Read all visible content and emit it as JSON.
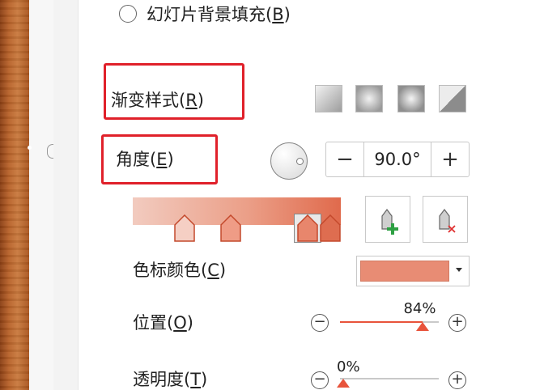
{
  "fill_options": {
    "slide_background_fill_label": "幻灯片背景填充",
    "slide_background_fill_key": "B"
  },
  "gradient": {
    "style_label": "渐变样式",
    "style_key": "R",
    "styles": [
      "linear",
      "radial",
      "rectangular",
      "path"
    ],
    "angle_label": "角度",
    "angle_key": "E",
    "angle_value": "90.0°",
    "decrement": "−",
    "increment": "+",
    "stops": [
      {
        "position": 0.25,
        "color": "#f5cfc4"
      },
      {
        "position": 0.47,
        "color": "#ef9c86"
      },
      {
        "position": 0.84,
        "color": "#e8866c",
        "selected": true
      },
      {
        "position": 0.95,
        "color": "#de6d50"
      }
    ]
  },
  "stop_color": {
    "label": "色标颜色",
    "key": "C",
    "value_color": "#e88c74"
  },
  "position": {
    "label": "位置",
    "key": "O",
    "value": "84%",
    "fraction": 0.84
  },
  "transparency": {
    "label": "透明度",
    "key": "T",
    "value": "0%",
    "fraction": 0.0
  },
  "colors": {
    "accent": "#e8533b",
    "highlight_box": "#e0202a",
    "add_icon": "#2ea043",
    "remove_icon": "#e03030"
  }
}
